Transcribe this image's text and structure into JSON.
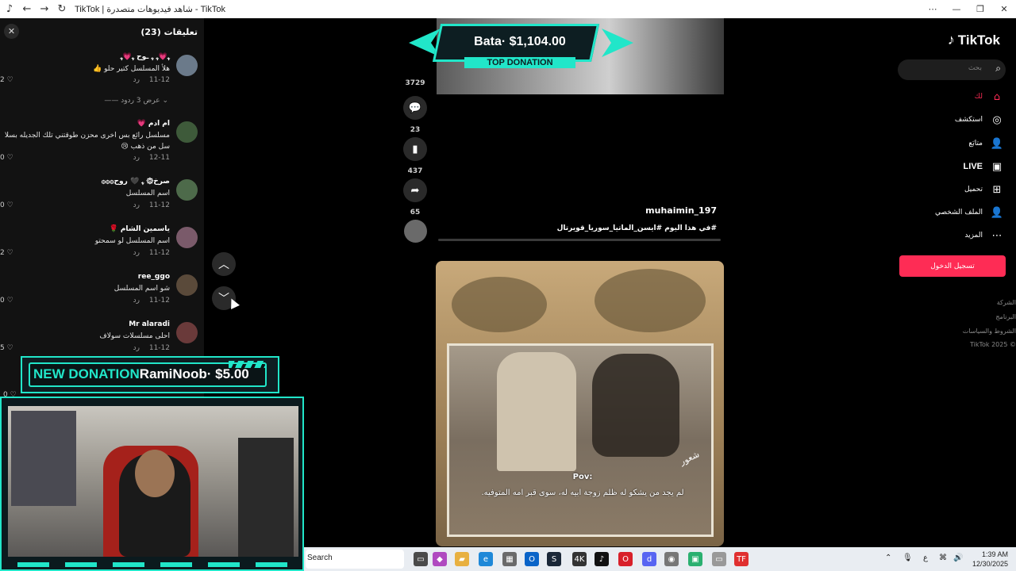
{
  "browser": {
    "title": "TikTok | شاهد فيديوهات متصدرة - TikTok"
  },
  "comments_panel": {
    "header": "تعليقات (23)",
    "items": [
      {
        "name": "ﮩ💗ﮩ ﮩ ـوح ﮩ💗ﮩ",
        "text": "هلأ المسلسل كتير حلو 👍",
        "date": "11-12",
        "reply": "رد",
        "likes": "2"
      },
      {
        "name": "ام ادم 💗",
        "text": "مسلسل رائع بس اخرى محزن طوقتني تلك الجديله بسلا سل من ذهب 😢",
        "date": "12-11",
        "reply": "رد",
        "likes": "0"
      },
      {
        "name": "صرخ۞ ﮩ 🖤 روح۞۞۞",
        "text": "اسم المسلسل",
        "date": "11-12",
        "reply": "رد",
        "likes": "0"
      },
      {
        "name": "ياسمين الشام 🌹",
        "text": "اسم المسلسل لو سمحتو",
        "date": "11-12",
        "reply": "رد",
        "likes": "2"
      },
      {
        "name": "ree_ggo",
        "text": "شو اسم المسلسل",
        "date": "11-12",
        "reply": "رد",
        "likes": "0"
      },
      {
        "name": "Mr alaradi",
        "text": "احلى مسلسلات سولاف",
        "date": "11-12",
        "reply": "رد",
        "likes": "5"
      }
    ],
    "show_replies": "عرض 3 ردود",
    "last_likes": "0"
  },
  "overlay": {
    "top_donation_amount": "Bata· $1,104.00",
    "top_donation_label": "TOP DONATION",
    "new_donation_tag": "NEW DONATION",
    "new_donation_text": "RamiNoob· $5.00"
  },
  "video": {
    "likes": "3729",
    "comments": "23",
    "saves": "437",
    "shares": "65",
    "author": "muhaimin_197",
    "caption": "#في هذا اليوم #ايسن_الماتيا_سوريا_قويرتال",
    "pov": "Pov:",
    "subtitle": "لم يجد من يشكو له ظلم زوجة ابيه له، سوى قبر امه المتوفيه.",
    "watermark": "شعور"
  },
  "sidebar": {
    "logo": "TikTok",
    "search_placeholder": "بحث",
    "nav": [
      {
        "label": "لك",
        "icon": "home-icon"
      },
      {
        "label": "استكشف",
        "icon": "compass-icon"
      },
      {
        "label": "متابَع",
        "icon": "user-plus-icon"
      },
      {
        "label": "LIVE",
        "icon": "live-icon"
      },
      {
        "label": "تحميل",
        "icon": "upload-icon"
      },
      {
        "label": "الملف الشخصي",
        "icon": "profile-icon"
      },
      {
        "label": "المزيد",
        "icon": "more-icon"
      }
    ],
    "login": "تسجيل الدخول",
    "footer": [
      "الشركة",
      "البرنامج",
      "الشروط والسياسات",
      "© 2025 TikTok"
    ]
  },
  "taskbar": {
    "search_label": "Search",
    "tray_lang": "ع",
    "time": "1:39 AM",
    "date": "12/30/2025"
  },
  "colors": {
    "accent": "#fe2c55",
    "overlay": "#21e6c9"
  }
}
